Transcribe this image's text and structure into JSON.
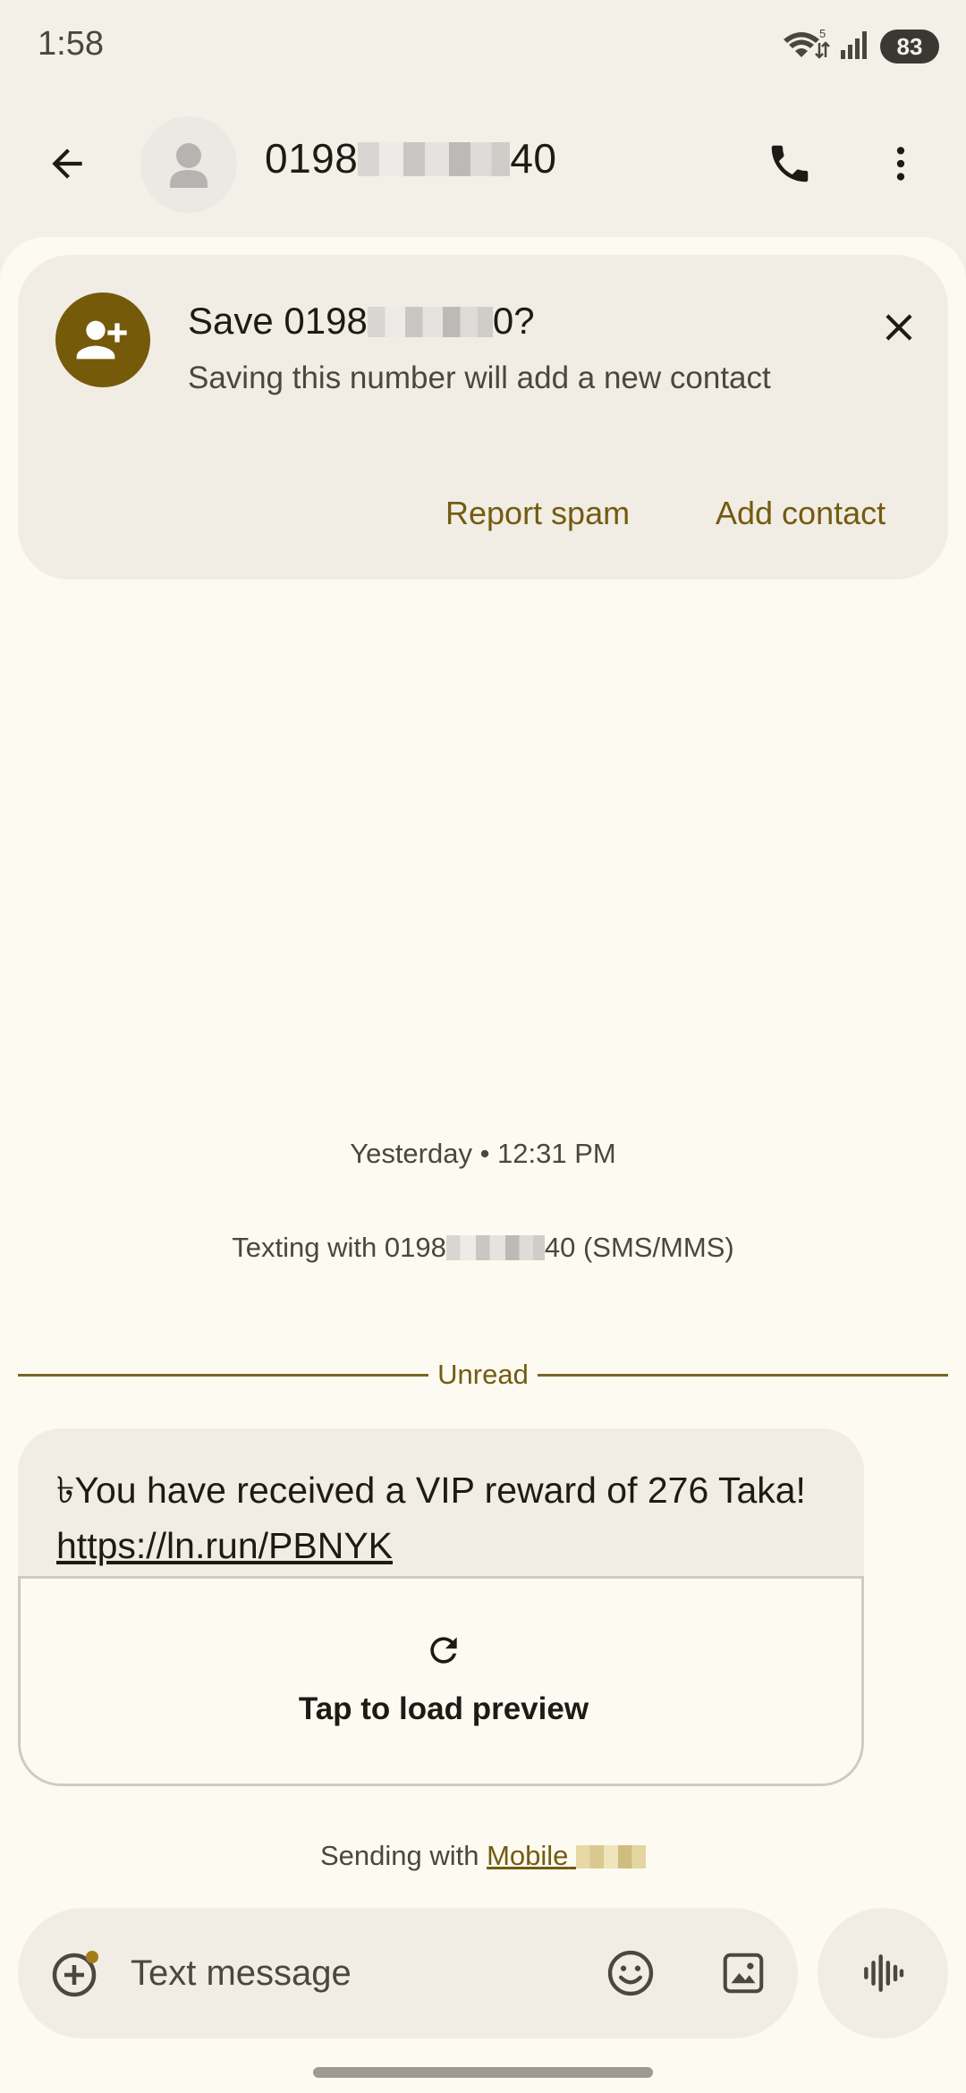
{
  "status_bar": {
    "time": "1:58",
    "wifi_badge": "5",
    "battery": "83"
  },
  "app_bar": {
    "number_prefix": "0198",
    "number_suffix": "40",
    "back_icon": "arrow-back-icon",
    "call_icon": "phone-icon",
    "more_icon": "more-vert-icon"
  },
  "save_card": {
    "title_prefix": "Save 0198",
    "title_suffix": "0?",
    "subtitle": "Saving this number will add a new contact",
    "report_spam": "Report spam",
    "add_contact": "Add contact",
    "accent": "#755a0a"
  },
  "conversation": {
    "date": "Yesterday • 12:31 PM",
    "texting_prefix": "Texting with 0198",
    "texting_suffix": "40 (SMS/MMS)",
    "unread": "Unread",
    "message_text": "৳You have received a VIP reward of 276 Taka! ",
    "message_link": "https://ln.run/PBNYK",
    "preview_label": "Tap to load preview",
    "sending_prefix": "Sending with ",
    "sending_sim": "Mobile"
  },
  "compose": {
    "placeholder": "Text message",
    "value": ""
  }
}
